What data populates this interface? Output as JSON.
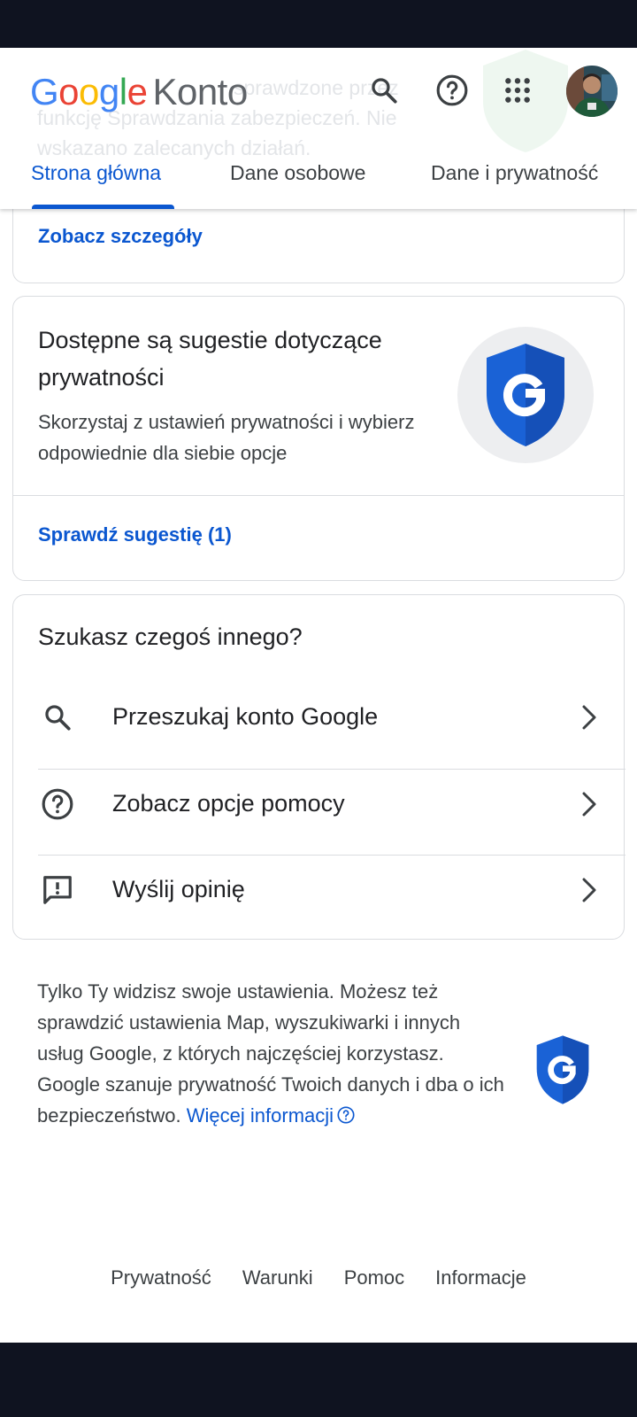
{
  "header": {
    "ghost_lines": [
      "sprawdzone przez",
      "funkcję Sprawdzania zabezpieczeń. Nie",
      "wskazano zalecanych działań."
    ],
    "logo_google": [
      "G",
      "o",
      "o",
      "g",
      "l",
      "e"
    ],
    "logo_konto": "Konto",
    "icons": [
      "search-icon",
      "help-icon",
      "apps-icon",
      "avatar"
    ],
    "tabs": [
      {
        "label": "Strona główna",
        "active": true
      },
      {
        "label": "Dane osobowe",
        "active": false
      },
      {
        "label": "Dane i prywatność",
        "active": false
      }
    ]
  },
  "security_card": {
    "details_link": "Zobacz szczegóły"
  },
  "privacy_card": {
    "title": "Dostępne są sugestie dotyczące prywatności",
    "description": "Skorzystaj z ustawień prywatności i wybierz odpowiednie dla siebie opcje",
    "action_link": "Sprawdź sugestię (1)"
  },
  "search_card": {
    "title": "Szukasz czegoś innego?",
    "items": [
      {
        "label": "Przeszukaj konto Google",
        "icon": "search-icon"
      },
      {
        "label": "Zobacz opcje pomocy",
        "icon": "help-icon"
      },
      {
        "label": "Wyślij opinię",
        "icon": "feedback-icon"
      }
    ]
  },
  "privacy_notice": {
    "text": "Tylko Ty widzisz swoje ustawienia. Możesz też sprawdzić ustawienia Map, wyszukiwarki i innych usług Google, z których najczęściej korzystasz. Google szanuje prywatność Twoich danych i dba o ich bezpieczeństwo.",
    "link": "Więcej informacji"
  },
  "footer": {
    "links": [
      "Prywatność",
      "Warunki",
      "Pomoc",
      "Informacje"
    ]
  },
  "colors": {
    "accent": "#0b57d0",
    "shield": "#1a62d6",
    "system_bars": "#0f1320"
  }
}
